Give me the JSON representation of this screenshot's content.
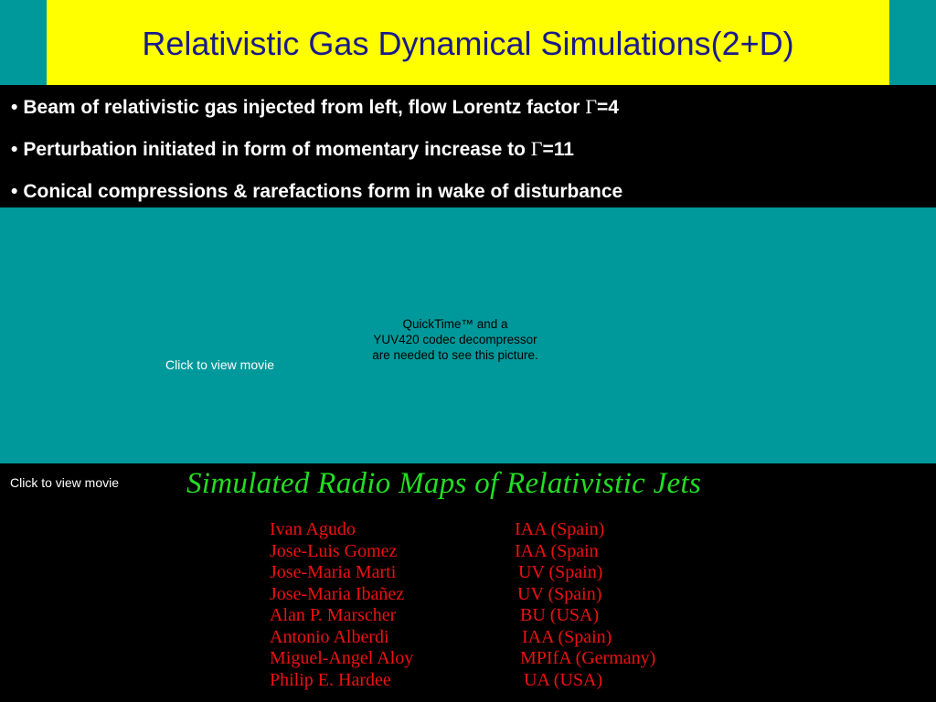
{
  "title": "Relativistic Gas Dynamical Simulations(2+D)",
  "bullets": [
    {
      "dot": "•",
      "before": "Beam of relativistic gas injected from left, flow Lorentz factor ",
      "symbol": "Γ",
      "after": "=4"
    },
    {
      "dot": "•",
      "before": "Perturbation initiated in form of momentary increase to ",
      "symbol": "Γ",
      "after": "=11"
    },
    {
      "dot": "•",
      "before": "Conical compressions & rarefactions form in wake of disturbance",
      "symbol": "",
      "after": ""
    }
  ],
  "movie1": {
    "click_label": "Click to view movie",
    "quicktime_lines": [
      "QuickTime™ and a",
      "YUV420 codec decompressor",
      "are needed to see this picture."
    ]
  },
  "movie2": {
    "click_label": "Click to view movie",
    "heading": "Simulated Radio Maps of Relativistic Jets"
  },
  "people": [
    {
      "name": "Ivan Agudo",
      "affiliation": "IAA (Spain)"
    },
    {
      "name": "Jose-Luis Gomez",
      "affiliation": "IAA (Spain"
    },
    {
      "name": "Jose-Maria Marti",
      "affiliation": "UV (Spain)"
    },
    {
      "name": "Jose-Maria Ibañez",
      "affiliation": "UV (Spain)"
    },
    {
      "name": "Alan P. Marscher",
      "affiliation": "BU (USA)"
    },
    {
      "name": "Antonio Alberdi",
      "affiliation": "IAA (Spain)"
    },
    {
      "name": "Miguel-Angel Aloy",
      "affiliation": "MPIfA (Germany)"
    },
    {
      "name": "Philip E. Hardee",
      "affiliation": "UA (USA)"
    }
  ],
  "colors": {
    "background": "#00999b",
    "title_bar": "#ffff00",
    "title_text": "#1a1a8c",
    "heading_green": "#22dd22",
    "names_red": "#ee1111"
  }
}
